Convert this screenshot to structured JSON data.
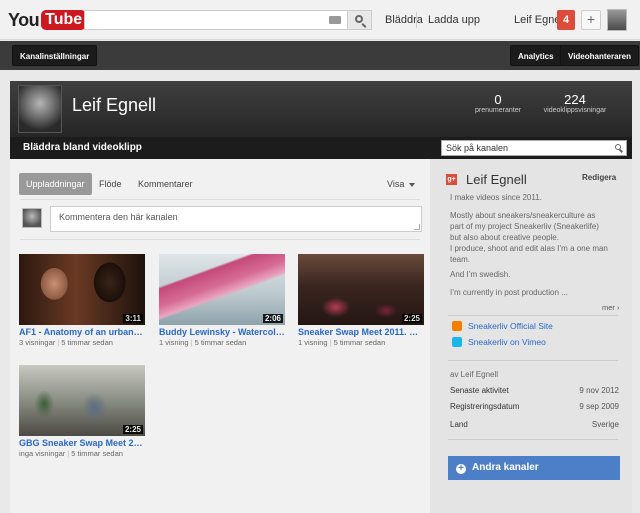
{
  "masthead": {
    "logo_you": "You",
    "logo_tube": "Tube",
    "nav_browse": "Bläddra",
    "nav_upload": "Ladda upp",
    "user_name": "Leif Egnell",
    "notification_count": "4",
    "plus": "+"
  },
  "toolbar": {
    "channel_settings": "Kanalinställningar",
    "analytics": "Analytics",
    "video_manager": "Videohanteraren"
  },
  "channel": {
    "name": "Leif Egnell",
    "subscribers_count": "0",
    "subscribers_label": "prenumeranter",
    "views_count": "224",
    "views_label": "videoklippsvisningar",
    "browse_tab": "Bläddra bland videoklipp",
    "search_placeholder": "Sök på kanalen"
  },
  "feed": {
    "tabs": [
      "Uppladdningar",
      "Flöde",
      "Kommentarer"
    ],
    "visa": "Visa",
    "comment_placeholder": "Kommentera den här kanalen"
  },
  "videos": [
    {
      "title": "AF1 - Anatomy of an urban le...",
      "views": "3 visningar",
      "age": "5 timmar sedan",
      "duration": "3:11"
    },
    {
      "title": "Buddy Lewinsky - Watercolo...",
      "views": "1 visning",
      "age": "5 timmar sedan",
      "duration": "2:06"
    },
    {
      "title": "Sneaker Swap Meet 2011. St...",
      "views": "1 visning",
      "age": "5 timmar sedan",
      "duration": "2:25"
    },
    {
      "title": "GBG Sneaker Swap Meet 2011.",
      "views": "inga visningar",
      "age": "5 timmar sedan",
      "duration": "2:25"
    }
  ],
  "about": {
    "title_icon": "g+",
    "name": "Leif Egnell",
    "edit": "Redigera",
    "lines": [
      "I make videos since 2011.",
      "Mostly about sneakers/sneakerculture as part of my project Sneakerliv (Sneakerlife) but also about creative people.",
      "I produce, shoot and edit alas I’m a one man team.",
      "And I’m swedish.",
      "I’m currently in post production ..."
    ],
    "more": "mer ›",
    "links": [
      {
        "label": "Sneakerliv Official Site",
        "icon": "blogger-icon",
        "color": "#f57d00"
      },
      {
        "label": "Sneakerliv on Vimeo",
        "icon": "vimeo-icon",
        "color": "#1ab7ea"
      }
    ],
    "by": "av Leif Egnell",
    "rows": [
      {
        "label": "Senaste aktivitet",
        "value": "9 nov 2012"
      },
      {
        "label": "Registreringsdatum",
        "value": "9 sep 2009"
      },
      {
        "label": "Land",
        "value": "Sverige"
      }
    ],
    "other_channels": "Andra kanaler"
  }
}
